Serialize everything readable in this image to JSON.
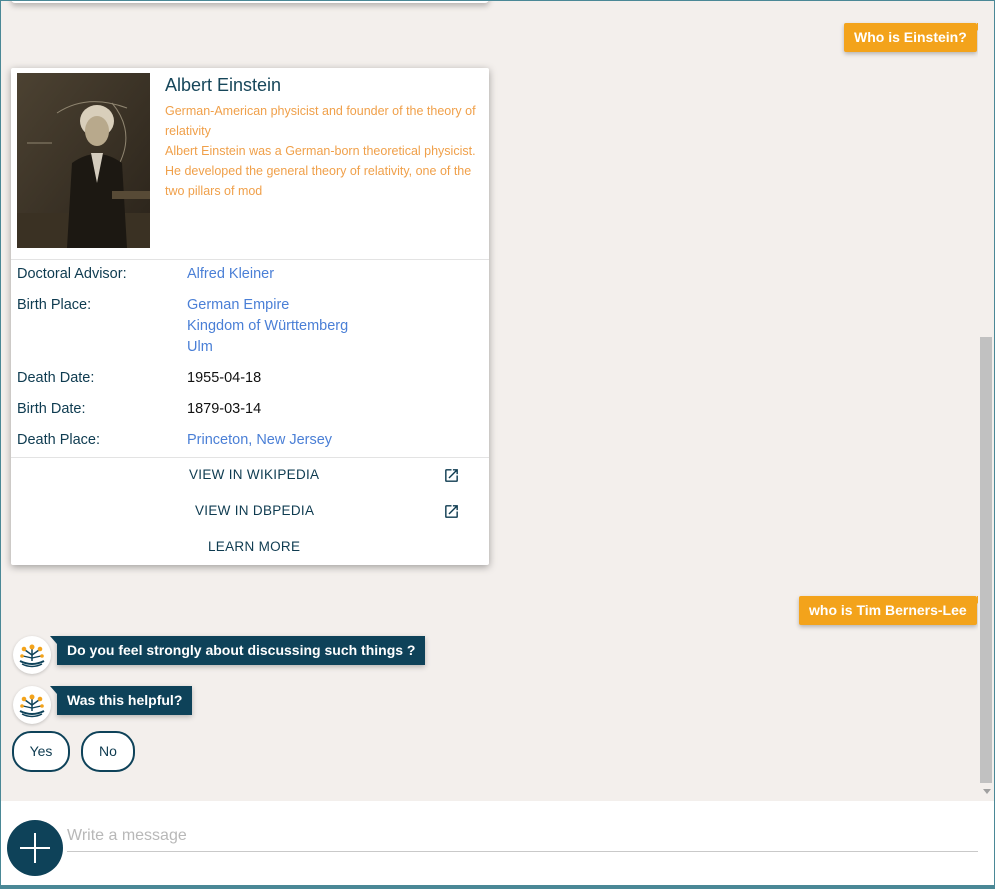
{
  "messages": {
    "user_1": "Who is Einstein?",
    "user_2": "who is Tim Berners-Lee",
    "bot_1": "Do you feel strongly about discussing such things ?",
    "bot_2": "Was this helpful?"
  },
  "card": {
    "title": "Albert Einstein",
    "description_1": "German-American physicist and founder of the theory of relativity",
    "description_2": "Albert Einstein was a German-born theoretical physicist. He developed the general theory of relativity, one of the two pillars of mod",
    "properties": {
      "doctoral_advisor": {
        "label": "Doctoral Advisor:",
        "value": "Alfred Kleiner"
      },
      "birth_place": {
        "label": "Birth Place:",
        "values": [
          "German Empire",
          "Kingdom of Württemberg",
          "Ulm"
        ]
      },
      "death_date": {
        "label": "Death Date:",
        "value": "1955-04-18"
      },
      "birth_date": {
        "label": "Birth Date:",
        "value": "1879-03-14"
      },
      "death_place": {
        "label": "Death Place:",
        "value": "Princeton, New Jersey"
      }
    },
    "actions": {
      "wikipedia": "VIEW IN WIKIPEDIA",
      "dbpedia": "VIEW IN DBPEDIA",
      "learn_more": "LEARN MORE"
    }
  },
  "quick_replies": {
    "yes": "Yes",
    "no": "No"
  },
  "composer": {
    "placeholder": "Write a message"
  },
  "icons": {
    "external_link": "external-link-icon",
    "plus": "plus-icon",
    "bot_avatar": "bot-avatar-icon"
  },
  "colors": {
    "user_bubble": "#f3a31b",
    "bot_bubble": "#0e4259",
    "link": "#4a7fd6",
    "description": "#f0a04a",
    "background": "#f3efec"
  }
}
